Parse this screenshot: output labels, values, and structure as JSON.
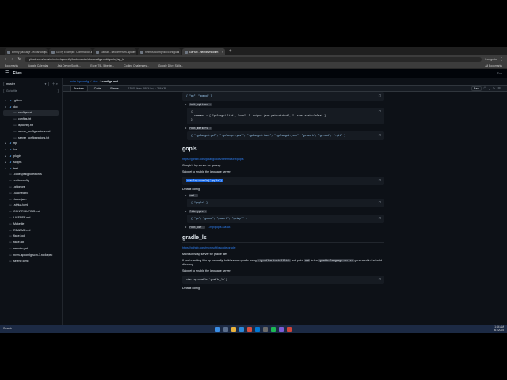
{
  "browser": {
    "tabs": [
      {
        "title": "Emmy package - ecosrsktopi...",
        "active": false
      },
      {
        "title": "Go by Example: Command-Lin...",
        "active": false
      },
      {
        "title": "GitHub - neovim/nvim-lspconf",
        "active": false
      },
      {
        "title": "nvim-lspconfig/doc/configura",
        "active": false
      },
      {
        "title": "GitHub - neovim/neovim",
        "active": true
      }
    ],
    "new_tab": "+",
    "url": "github.com/neovim/nvim-lspconfig/blob/master/doc/configs.md#gopls_lsp_lu",
    "incognito": "Incognito",
    "bookmarks": [
      "Bookmarks",
      "Google Calendar",
      "Ask Devon Scotts...",
      "Excel 75 - 5 better...",
      "Coding Challenges...",
      "Google Drive Skills..."
    ],
    "all_bookmarks": "All Bookmarks"
  },
  "github": {
    "title": "Files",
    "top_right": "Top"
  },
  "sidebar": {
    "branch": "master",
    "go_to_file": "Go to file",
    "items": [
      {
        "name": ".github",
        "type": "dir",
        "depth": 0
      },
      {
        "name": "doc",
        "type": "dir",
        "depth": 0,
        "open": true
      },
      {
        "name": "configs.md",
        "type": "file",
        "depth": 1,
        "selected": true
      },
      {
        "name": "configs.txt",
        "type": "file",
        "depth": 1
      },
      {
        "name": "lspconfig.txt",
        "type": "file",
        "depth": 1
      },
      {
        "name": "server_configurations.md",
        "type": "file",
        "depth": 1
      },
      {
        "name": "server_configurations.txt",
        "type": "file",
        "depth": 1
      },
      {
        "name": "ftp",
        "type": "dir",
        "depth": 0
      },
      {
        "name": "lua",
        "type": "dir",
        "depth": 0
      },
      {
        "name": "plugin",
        "type": "dir",
        "depth": 0
      },
      {
        "name": "scripts",
        "type": "dir",
        "depth": 0
      },
      {
        "name": "test",
        "type": "dir",
        "depth": 0
      },
      {
        "name": ".codespellignorewords",
        "type": "file",
        "depth": 0
      },
      {
        "name": ".editorconfig",
        "type": "file",
        "depth": 0
      },
      {
        "name": ".gitignore",
        "type": "file",
        "depth": 0
      },
      {
        "name": ".luacheckrc",
        "type": "file",
        "depth": 0
      },
      {
        "name": ".luarc.json",
        "type": "file",
        "depth": 0
      },
      {
        "name": ".stylua.toml",
        "type": "file",
        "depth": 0
      },
      {
        "name": "CONTRIBUTING.md",
        "type": "file",
        "depth": 0
      },
      {
        "name": "LICENSE.md",
        "type": "file",
        "depth": 0
      },
      {
        "name": "Makefile",
        "type": "file",
        "depth": 0
      },
      {
        "name": "README.md",
        "type": "file",
        "depth": 0
      },
      {
        "name": "flake.lock",
        "type": "file",
        "depth": 0
      },
      {
        "name": "flake.nix",
        "type": "file",
        "depth": 0
      },
      {
        "name": "neovim.yml",
        "type": "file",
        "depth": 0
      },
      {
        "name": "nvim-lspconfig-scm-1.rockspec",
        "type": "file",
        "depth": 0
      },
      {
        "name": "selene.toml",
        "type": "file",
        "depth": 0
      }
    ]
  },
  "file": {
    "breadcrumb": [
      "nvim-lspconfig",
      "doc",
      "configs.md"
    ],
    "views": [
      "Preview",
      "Code",
      "Blame"
    ],
    "active_view": "Preview",
    "meta": "13805 lines (9974 loc) · 286 KB",
    "raw": "Raw"
  },
  "markdown": {
    "code_top": "{ \"go\", \"gomod\" }",
    "init_options_label": "init_options :",
    "init_options_code": "{\n  command = { \"golangci-lint\", \"run\", \"--output.json.path=stdout\", \"--show-stats=false\" }\n}",
    "root_markers_label": "root_markers :",
    "root_markers_code": "{ \".golangci.yml\", \".golangci.yaml\", \".golangci.toml\", \".golangci.json\", \"go.work\", \"go.mod\", \".git\" }",
    "gopls_heading": "gopls",
    "gopls_link": "https://github.com/golang/tools/tree/master/gopls",
    "gopls_desc": "Google's lsp server for golang.",
    "snippet_label": "Snippet to enable the language server:",
    "gopls_enable": "vim.lsp.enable('gopls')",
    "default_config": "Default config:",
    "cmd_label": "cmd :",
    "gopls_cmd": "{ \"gopls\" }",
    "filetypes_label": "filetypes :",
    "gopls_filetypes": "{ \"go\", \"gomod\", \"gowork\", \"gotmpl\" }",
    "root_dir_label": "root_dir :",
    "root_dir_link": "../lsp/gopls.lua:58",
    "gradle_heading": "gradle_ls",
    "gradle_link": "https://github.com/microsoft/vscode-gradle",
    "gradle_desc": "Microsoft's lsp server for gradle files",
    "gradle_note_1": "If you're setting this up manually, build vscode-gradle using",
    "gradle_note_code1": "./gradlew installDist",
    "gradle_note_2": "and point",
    "gradle_note_code2": "cmd",
    "gradle_note_3": "to the",
    "gradle_note_code3": "gradle-language-server",
    "gradle_note_4": "generated in the build directory",
    "gradle_enable": "vim.lsp.enable('gradle_ls')",
    "default_config_2": "Default config:"
  },
  "taskbar": {
    "search": "Search",
    "time": "1:44 AM",
    "date": "8/1/2025"
  },
  "colors": {
    "bg": "#0d1117",
    "link": "#2f81f7",
    "taskbar": "#1c2a44"
  }
}
